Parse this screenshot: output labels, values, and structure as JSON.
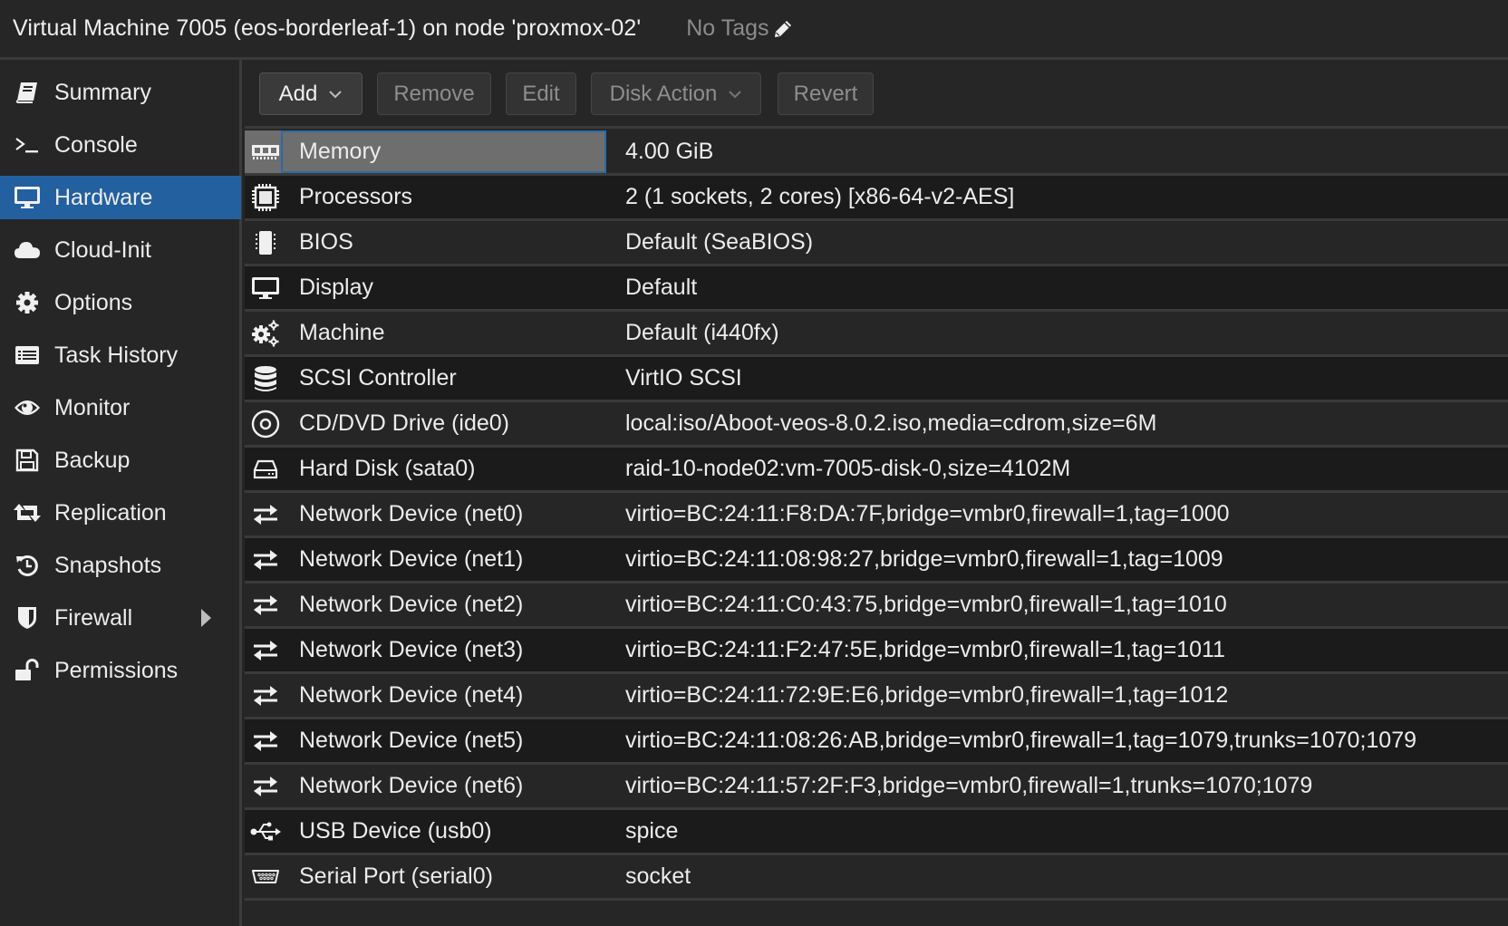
{
  "header": {
    "title": "Virtual Machine 7005 (eos-borderleaf-1) on node 'proxmox-02'",
    "tags_label": "No Tags",
    "tags_icon": "pencil-icon"
  },
  "sidebar": {
    "active": "Hardware",
    "items": [
      {
        "label": "Summary",
        "icon": "book-icon"
      },
      {
        "label": "Console",
        "icon": "terminal-icon"
      },
      {
        "label": "Hardware",
        "icon": "desktop-icon"
      },
      {
        "label": "Cloud-Init",
        "icon": "cloud-icon"
      },
      {
        "label": "Options",
        "icon": "gear-icon"
      },
      {
        "label": "Task History",
        "icon": "list-alt-icon"
      },
      {
        "label": "Monitor",
        "icon": "eye-icon"
      },
      {
        "label": "Backup",
        "icon": "floppy-icon"
      },
      {
        "label": "Replication",
        "icon": "retweet-icon"
      },
      {
        "label": "Snapshots",
        "icon": "history-icon"
      },
      {
        "label": "Firewall",
        "icon": "shield-icon",
        "expandable": true
      },
      {
        "label": "Permissions",
        "icon": "unlock-icon"
      }
    ]
  },
  "toolbar": {
    "add_label": "Add",
    "remove_label": "Remove",
    "edit_label": "Edit",
    "disk_action_label": "Disk Action",
    "revert_label": "Revert"
  },
  "hardware": {
    "selected": "Memory",
    "rows": [
      {
        "name": "Memory",
        "value": "4.00 GiB",
        "icon": "memory-icon"
      },
      {
        "name": "Processors",
        "value": "2 (1 sockets, 2 cores) [x86-64-v2-AES]",
        "icon": "cpu-icon"
      },
      {
        "name": "BIOS",
        "value": "Default (SeaBIOS)",
        "icon": "microchip-icon"
      },
      {
        "name": "Display",
        "value": "Default",
        "icon": "desktop-icon"
      },
      {
        "name": "Machine",
        "value": "Default (i440fx)",
        "icon": "cogs-icon"
      },
      {
        "name": "SCSI Controller",
        "value": "VirtIO SCSI",
        "icon": "database-icon"
      },
      {
        "name": "CD/DVD Drive (ide0)",
        "value": "local:iso/Aboot-veos-8.0.2.iso,media=cdrom,size=6M",
        "icon": "cdrom-icon"
      },
      {
        "name": "Hard Disk (sata0)",
        "value": "raid-10-node02:vm-7005-disk-0,size=4102M",
        "icon": "hdd-icon"
      },
      {
        "name": "Network Device (net0)",
        "value": "virtio=BC:24:11:F8:DA:7F,bridge=vmbr0,firewall=1,tag=1000",
        "icon": "exchange-icon"
      },
      {
        "name": "Network Device (net1)",
        "value": "virtio=BC:24:11:08:98:27,bridge=vmbr0,firewall=1,tag=1009",
        "icon": "exchange-icon"
      },
      {
        "name": "Network Device (net2)",
        "value": "virtio=BC:24:11:C0:43:75,bridge=vmbr0,firewall=1,tag=1010",
        "icon": "exchange-icon"
      },
      {
        "name": "Network Device (net3)",
        "value": "virtio=BC:24:11:F2:47:5E,bridge=vmbr0,firewall=1,tag=1011",
        "icon": "exchange-icon"
      },
      {
        "name": "Network Device (net4)",
        "value": "virtio=BC:24:11:72:9E:E6,bridge=vmbr0,firewall=1,tag=1012",
        "icon": "exchange-icon"
      },
      {
        "name": "Network Device (net5)",
        "value": "virtio=BC:24:11:08:26:AB,bridge=vmbr0,firewall=1,tag=1079,trunks=1070;1079",
        "icon": "exchange-icon"
      },
      {
        "name": "Network Device (net6)",
        "value": "virtio=BC:24:11:57:2F:F3,bridge=vmbr0,firewall=1,trunks=1070;1079",
        "icon": "exchange-icon"
      },
      {
        "name": "USB Device (usb0)",
        "value": "spice",
        "icon": "usb-icon"
      },
      {
        "name": "Serial Port (serial0)",
        "value": "socket",
        "icon": "serial-port-icon"
      }
    ]
  },
  "colors": {
    "accent": "#23609f",
    "selection_border": "#2e6aa5",
    "background": "#262626",
    "row_alt": "#1b1b1b"
  }
}
